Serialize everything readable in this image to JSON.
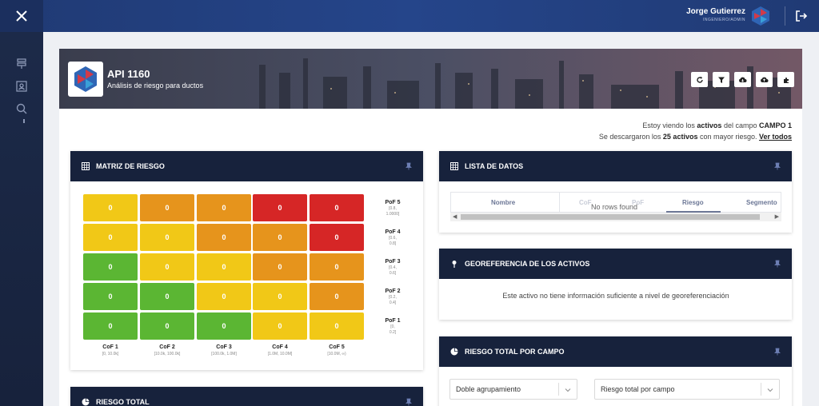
{
  "topbar": {
    "user_name": "Jorge Gutierrez",
    "user_role": "INGENIERO/ADMIN"
  },
  "sidebar": {
    "icons": [
      "pipeline-icon",
      "contacts-icon",
      "search-icon"
    ]
  },
  "hero": {
    "title": "API 1160",
    "subtitle": "Análisis de riesgo para ductos",
    "buttons": [
      "refresh-icon",
      "filter-icon",
      "cloud-download-icon",
      "cloud-upload-icon",
      "puzzle-icon"
    ]
  },
  "info": {
    "line1_pre": "Estoy viendo los ",
    "line1_bold": "activos",
    "line1_mid": " del campo ",
    "line1_field": "CAMPO 1",
    "line2_pre": "Se descargaron los ",
    "line2_bold": "25 activos",
    "line2_mid": " con mayor riesgo. ",
    "line2_link": "Ver todos"
  },
  "matrix": {
    "title": "MATRIZ DE RIESGO",
    "rows": [
      {
        "cells": [
          {
            "v": "0",
            "c": "yellow"
          },
          {
            "v": "0",
            "c": "orange"
          },
          {
            "v": "0",
            "c": "orange"
          },
          {
            "v": "0",
            "c": "red"
          },
          {
            "v": "0",
            "c": "red"
          }
        ]
      },
      {
        "cells": [
          {
            "v": "0",
            "c": "yellow"
          },
          {
            "v": "0",
            "c": "yellow"
          },
          {
            "v": "0",
            "c": "orange"
          },
          {
            "v": "0",
            "c": "orange"
          },
          {
            "v": "0",
            "c": "red"
          }
        ]
      },
      {
        "cells": [
          {
            "v": "0",
            "c": "green"
          },
          {
            "v": "0",
            "c": "yellow"
          },
          {
            "v": "0",
            "c": "yellow"
          },
          {
            "v": "0",
            "c": "orange"
          },
          {
            "v": "0",
            "c": "orange"
          }
        ]
      },
      {
        "cells": [
          {
            "v": "0",
            "c": "green"
          },
          {
            "v": "0",
            "c": "green"
          },
          {
            "v": "0",
            "c": "yellow"
          },
          {
            "v": "0",
            "c": "yellow"
          },
          {
            "v": "0",
            "c": "orange"
          }
        ]
      },
      {
        "cells": [
          {
            "v": "0",
            "c": "green"
          },
          {
            "v": "0",
            "c": "green"
          },
          {
            "v": "0",
            "c": "green"
          },
          {
            "v": "0",
            "c": "yellow"
          },
          {
            "v": "0",
            "c": "yellow"
          }
        ]
      }
    ],
    "cof": [
      {
        "t": "CoF 1",
        "r": "[0, 10.0k]"
      },
      {
        "t": "CoF 2",
        "r": "[10.0k, 100.0k]"
      },
      {
        "t": "CoF 3",
        "r": "[100.0k, 1.0M]"
      },
      {
        "t": "CoF 4",
        "r": "[1.0M, 10.0M]"
      },
      {
        "t": "CoF 5",
        "r": "[10.0M, ∞)"
      }
    ],
    "pof": [
      {
        "t": "PoF 5",
        "r1": "[0.8,",
        "r2": "1.0000]"
      },
      {
        "t": "PoF 4",
        "r1": "[0.6,",
        "r2": "0.8]"
      },
      {
        "t": "PoF 3",
        "r1": "[0.4,",
        "r2": "0.6]"
      },
      {
        "t": "PoF 2",
        "r1": "[0.2,",
        "r2": "0.4]"
      },
      {
        "t": "PoF 1",
        "r1": "[0,",
        "r2": "0.2]"
      }
    ],
    "colors": {
      "green": "#5bb633",
      "yellow": "#f1c817",
      "orange": "#e6941c",
      "red": "#d62626"
    }
  },
  "riesgo_total": {
    "title": "RIESGO TOTAL"
  },
  "lista": {
    "title": "LISTA DE DATOS",
    "columns": [
      "Nombre",
      "CoF",
      "PoF",
      "Riesgo",
      "Segmento"
    ],
    "empty_text": "No rows found"
  },
  "geo": {
    "title": "GEOREFERENCIA DE LOS ACTIVOS",
    "message": "Este activo no tiene información suficiente a nivel de georeferenciación"
  },
  "campo": {
    "title": "RIESGO TOTAL POR CAMPO",
    "select1": "Doble agrupamiento",
    "select2": "Riesgo total por campo"
  }
}
